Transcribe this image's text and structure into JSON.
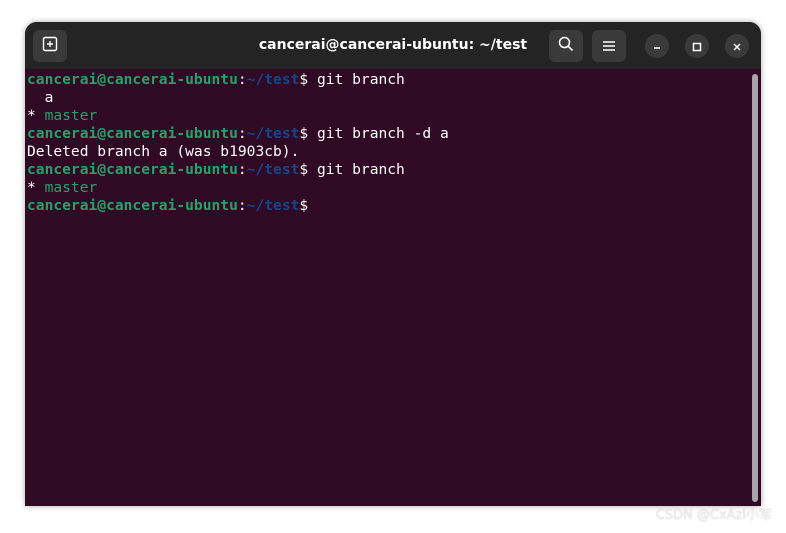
{
  "window": {
    "title": "cancerai@cancerai-ubuntu: ~/test"
  },
  "titlebar": {
    "new_tab_icon": "new-tab-icon",
    "search_icon": "search-icon",
    "menu_icon": "hamburger-menu-icon",
    "minimize_icon": "minimize-icon",
    "maximize_icon": "maximize-icon",
    "close_icon": "close-icon"
  },
  "terminal": {
    "prompt_user": "cancerai@cancerai-ubuntu",
    "prompt_colon": ":",
    "prompt_path": "~/test",
    "prompt_dollar": "$",
    "lines": [
      {
        "type": "prompt",
        "command": " git branch"
      },
      {
        "type": "output",
        "text": "  a"
      },
      {
        "type": "current",
        "text": "* ",
        "branch": "master"
      },
      {
        "type": "prompt",
        "command": " git branch -d a"
      },
      {
        "type": "output",
        "text": "Deleted branch a (was b1903cb)."
      },
      {
        "type": "prompt",
        "command": " git branch"
      },
      {
        "type": "current",
        "text": "* ",
        "branch": "master"
      },
      {
        "type": "prompt",
        "command": ""
      }
    ]
  },
  "colors": {
    "terminal_bg": "#300a24",
    "prompt_user": "#26a269",
    "prompt_path": "#12488b",
    "titlebar_bg": "#242424"
  },
  "watermark": "CSDN @CxAzl小军"
}
